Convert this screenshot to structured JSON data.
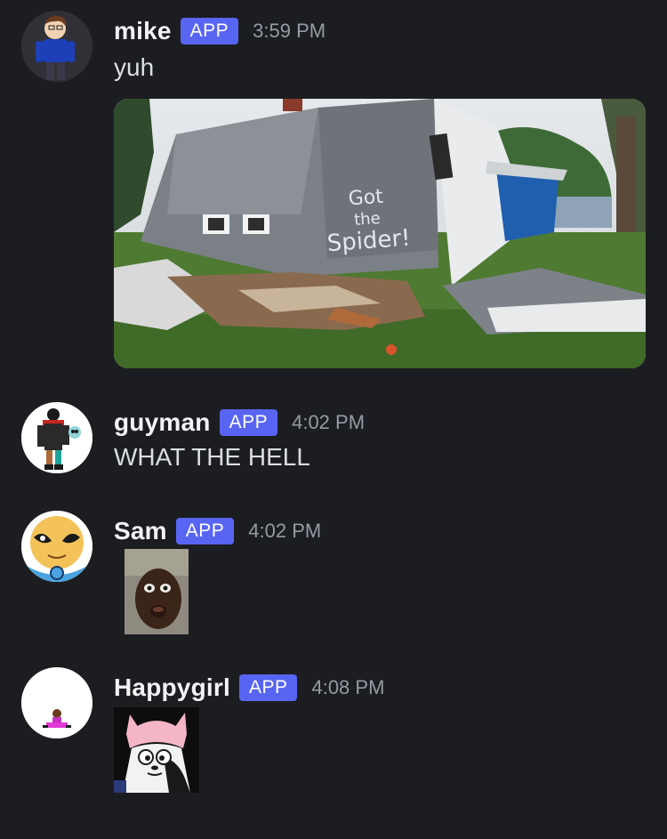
{
  "messages": [
    {
      "username": "mike",
      "badge": "APP",
      "time": "3:59 PM",
      "text": "yuh",
      "avatar_icon": "avatar-mike",
      "attachment_icon": "collapsed-house-image",
      "attachment_text": [
        "Got",
        "the",
        "Spider!"
      ]
    },
    {
      "username": "guyman",
      "badge": "APP",
      "time": "4:02 PM",
      "text": "WHAT THE HELL",
      "avatar_icon": "avatar-guyman"
    },
    {
      "username": "Sam",
      "badge": "APP",
      "time": "4:02 PM",
      "avatar_icon": "avatar-sam",
      "attachment_icon": "staring-face-image"
    },
    {
      "username": "Happygirl",
      "badge": "APP",
      "time": "4:08 PM",
      "avatar_icon": "avatar-happygirl",
      "attachment_icon": "cat-hat-image"
    }
  ],
  "colors": {
    "background": "#1c1d20",
    "badge": "#5865f2",
    "username": "#f2f3f5",
    "timestamp": "#949ba4",
    "text": "#dbdee1"
  }
}
